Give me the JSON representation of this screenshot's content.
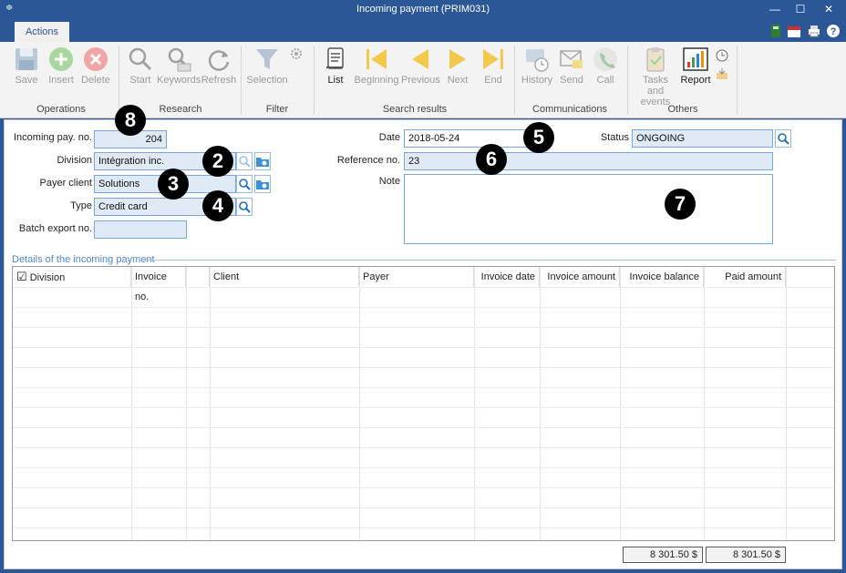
{
  "window": {
    "title": "Incoming payment (PRIM031)",
    "menu_glyph": "≑",
    "min_glyph": "—",
    "max_glyph": "☐",
    "close_glyph": "✕"
  },
  "tabs": [
    {
      "label": "Actions"
    }
  ],
  "ribbon": {
    "groups": [
      {
        "label": "Operations",
        "buttons": [
          "Save",
          "Insert",
          "Delete"
        ]
      },
      {
        "label": "Research",
        "buttons": [
          "Start",
          "Keywords",
          "Refresh"
        ]
      },
      {
        "label": "Filter",
        "buttons": [
          "Selection"
        ]
      },
      {
        "label": "Search results",
        "buttons": [
          "List",
          "Beginning",
          "Previous",
          "Next",
          "End"
        ]
      },
      {
        "label": "Communications",
        "buttons": [
          "History",
          "Send",
          "Call"
        ]
      },
      {
        "label": "Others",
        "buttons": [
          "Tasks and events",
          "Report"
        ]
      }
    ]
  },
  "form": {
    "incoming_pay_no": {
      "label": "Incoming pay. no.",
      "value": "204"
    },
    "division": {
      "label": "Division",
      "value": "Intégration inc."
    },
    "payer_client": {
      "label": "Payer client",
      "value": "Solutions"
    },
    "type": {
      "label": "Type",
      "value": "Credit card"
    },
    "batch_export_no": {
      "label": "Batch export no.",
      "value": ""
    },
    "date": {
      "label": "Date",
      "value": "2018-05-24"
    },
    "reference_no": {
      "label": "Reference no.",
      "value": "23"
    },
    "note": {
      "label": "Note",
      "value": ""
    },
    "status": {
      "label": "Status",
      "value": "ONGOING"
    }
  },
  "markers": [
    "8",
    "2",
    "3",
    "4",
    "5",
    "6",
    "7"
  ],
  "details": {
    "title": "Details of the incoming payment",
    "checkbox_glyph": "☑",
    "columns": [
      "Division",
      "Invoice no.",
      "",
      "Client",
      "Payer",
      "Invoice date",
      "Invoice amount",
      "Invoice balance",
      "Paid amount"
    ]
  },
  "totals": {
    "invoice_balance": "8 301.50 $",
    "paid_amount": "8 301.50 $"
  },
  "colors": {
    "titlebar": "#2b5797",
    "field_bg": "#dfeaf5",
    "field_border": "#7aa7d6",
    "accent": "#4d86c6"
  }
}
